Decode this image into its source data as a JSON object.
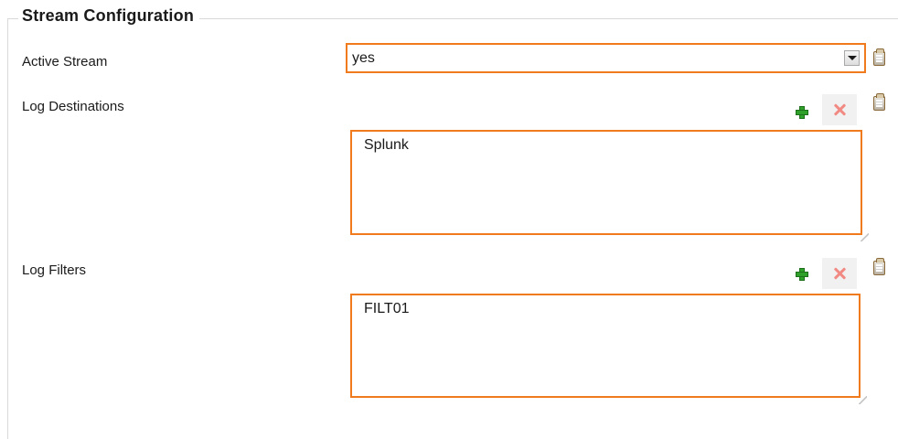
{
  "group": {
    "title": "Stream Configuration"
  },
  "active_stream": {
    "label": "Active Stream",
    "selected": "yes"
  },
  "log_destinations": {
    "label": "Log Destinations",
    "items": [
      "Splunk"
    ]
  },
  "log_filters": {
    "label": "Log Filters",
    "items": [
      "FILT01"
    ]
  },
  "icons": {
    "clipboard": "clipboard-icon",
    "add": "add-plus-icon",
    "remove": "remove-x-icon",
    "dropdown": "dropdown-arrow-icon"
  },
  "colors": {
    "highlight_border": "#f07a1e",
    "add_green": "#2fa12a",
    "remove_red": "#f28a84"
  }
}
